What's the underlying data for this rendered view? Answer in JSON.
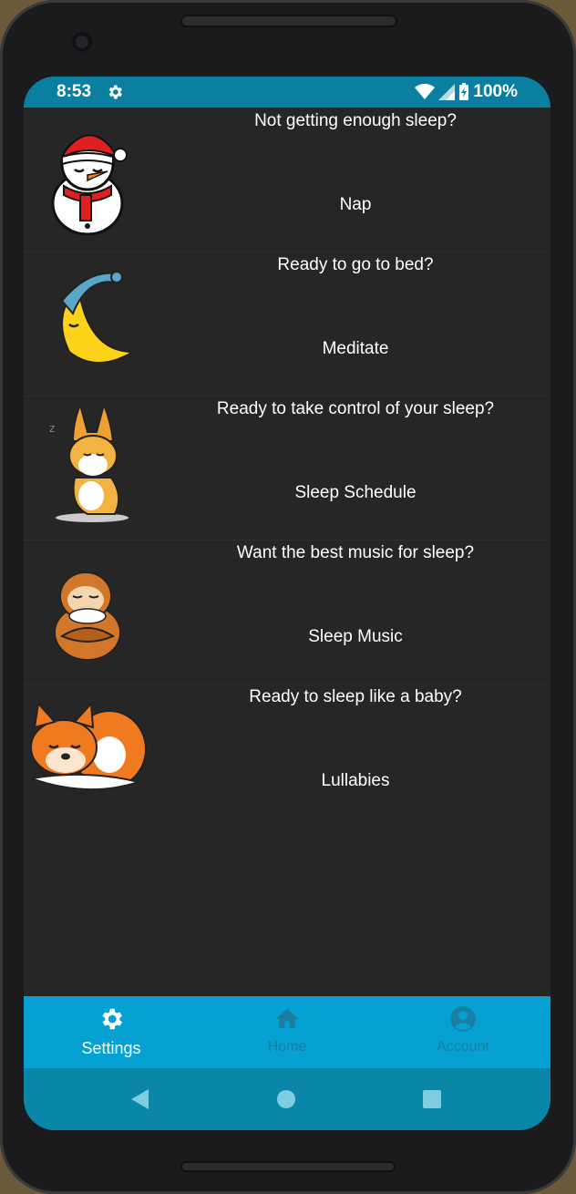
{
  "status": {
    "time": "8:53",
    "battery": "100%"
  },
  "rows": [
    {
      "question": "Not getting enough sleep?",
      "action": "Nap",
      "icon": "snowman-sleeping-icon"
    },
    {
      "question": "Ready to go to bed?",
      "action": "Meditate",
      "icon": "moon-nightcap-icon"
    },
    {
      "question": "Ready to take control of your sleep?",
      "action": "Sleep Schedule",
      "icon": "corgi-sleeping-icon"
    },
    {
      "question": "Want the best music for sleep?",
      "action": "Sleep Music",
      "icon": "sloth-hugging-icon"
    },
    {
      "question": "Ready to sleep like a baby?",
      "action": "Lullabies",
      "icon": "shiba-sleeping-icon"
    }
  ],
  "tabs": [
    {
      "label": "Settings",
      "icon": "gear-icon",
      "active": true
    },
    {
      "label": "Home",
      "icon": "home-icon",
      "active": false
    },
    {
      "label": "Account",
      "icon": "account-icon",
      "active": false
    }
  ],
  "colors": {
    "status_bar": "#0a7fa1",
    "tab_bar": "#05a1d2",
    "nav_bar": "#0a86a8",
    "background": "#262626",
    "tab_active": "#ffffff",
    "tab_inactive": "#1b7fa1"
  }
}
